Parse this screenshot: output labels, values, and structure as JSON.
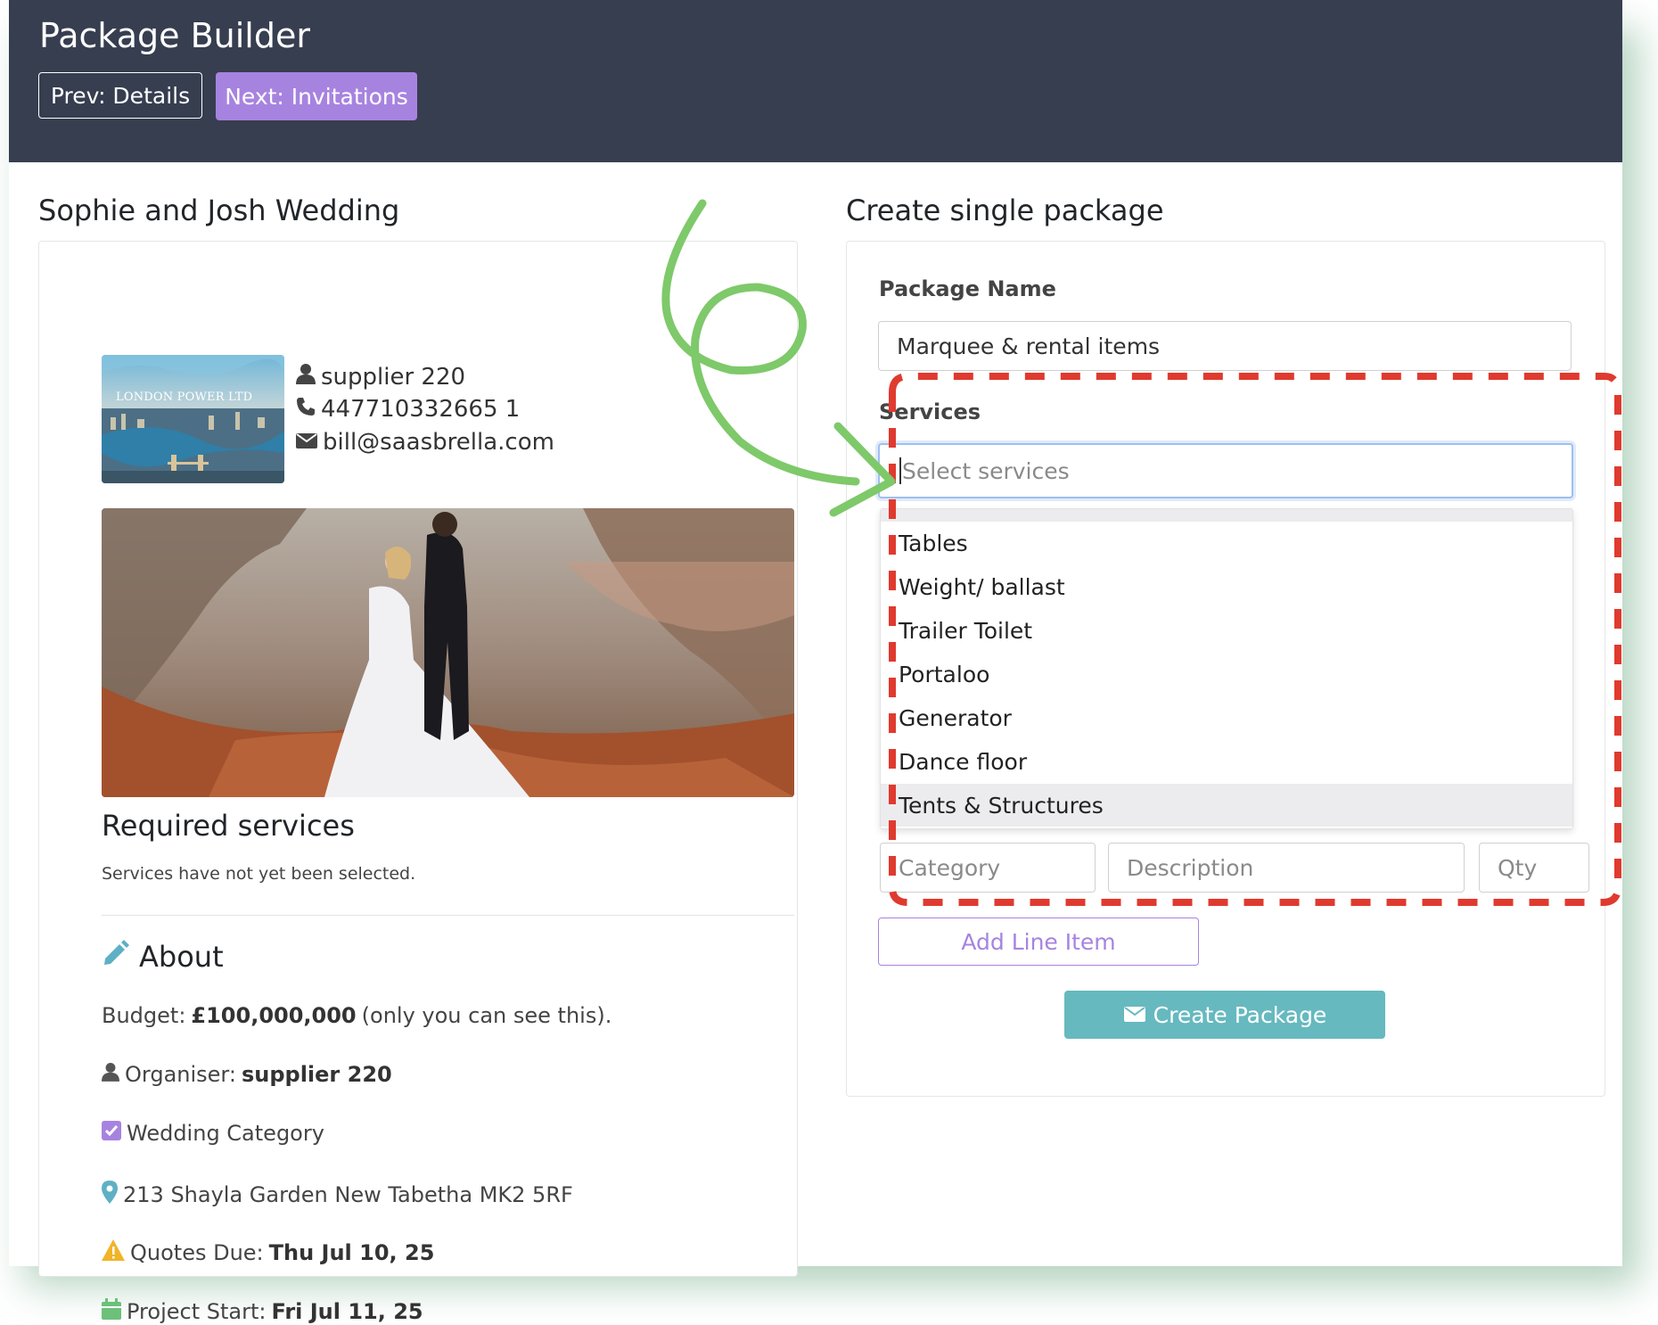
{
  "header": {
    "title": "Package Builder",
    "prev_label": "Prev: Details",
    "next_label": "Next: Invitations"
  },
  "event": {
    "title": "Sophie and Josh Wedding",
    "thumbnail_text": "LONDON POWER LTD",
    "contact": {
      "name": "supplier 220",
      "phone": "447710332665 1",
      "email": "bill@saasbrella.com"
    },
    "required_services_title": "Required services",
    "required_services_note": "Services have not yet been selected.",
    "about": {
      "title": "About",
      "budget_label": "Budget:",
      "budget_value": "£100,000,000",
      "budget_note": "(only you can see this).",
      "organiser_label": "Organiser:",
      "organiser_value": "supplier 220",
      "category": "Wedding Category",
      "address": "213 Shayla Garden New Tabetha MK2 5RF",
      "quotes_due_label": "Quotes Due:",
      "quotes_due_value": "Thu Jul 10, 25",
      "project_start_label": "Project Start:",
      "project_start_value": "Fri Jul 11, 25"
    }
  },
  "package": {
    "title": "Create single package",
    "name_label": "Package Name",
    "name_value": "Marquee & rental items",
    "services_label": "Services",
    "services_placeholder": "Select services",
    "service_options": [
      "Tables",
      "Weight/ ballast",
      "Trailer Toilet",
      "Portaloo",
      "Generator",
      "Dance floor",
      "Tents & Structures"
    ],
    "highlighted_option": "Tents & Structures",
    "line_item": {
      "category_placeholder": "Category",
      "description_placeholder": "Description",
      "qty_placeholder": "Qty"
    },
    "add_line_item_label": "Add Line Item",
    "create_label": "Create Package"
  },
  "colors": {
    "header_bg": "#363e50",
    "accent_purple": "#a783e0",
    "create_button": "#66b9bf",
    "annotation_red": "#e03a2f",
    "annotation_green": "#7ec96a"
  }
}
